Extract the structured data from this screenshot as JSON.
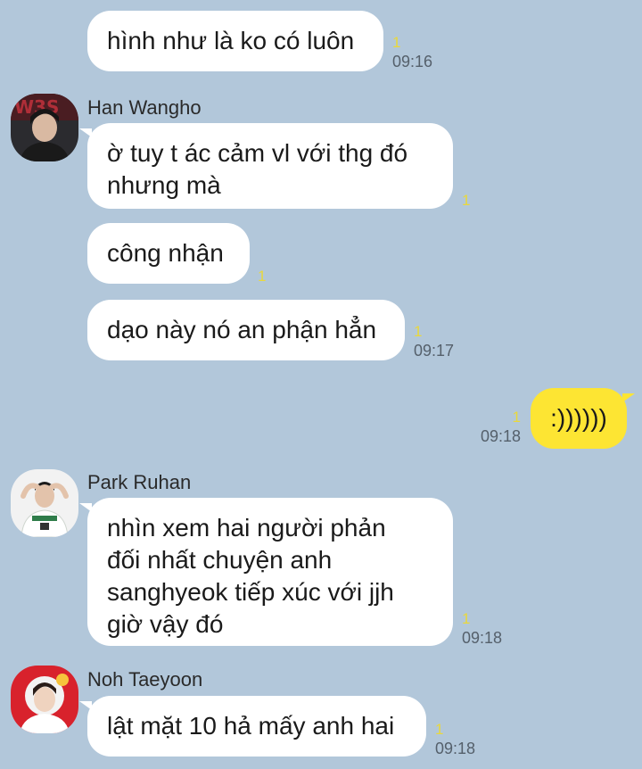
{
  "messages": {
    "m1": {
      "text": "hình như là ko có luôn",
      "unread": "1",
      "time": "09:16"
    },
    "m2": {
      "sender": "Han Wangho",
      "text": "ờ tuy t ác cảm vl với thg đó\nnhưng mà",
      "unread": "1"
    },
    "m3": {
      "text": "công nhận",
      "unread": "1"
    },
    "m4": {
      "text": "dạo này nó an phận hẳn",
      "unread": "1",
      "time": "09:17"
    },
    "m5": {
      "text": ":))))))",
      "unread": "1",
      "time": "09:18"
    },
    "m6": {
      "sender": "Park Ruhan",
      "text": "nhìn xem hai người phản\nđối nhất chuyện anh\nsanghyeok tiếp xúc với jjh\ngiờ vậy đó",
      "unread": "1",
      "time": "09:18"
    },
    "m7": {
      "sender": "Noh Taeyoon",
      "text": "lật mặt 10 hả mấy anh hai",
      "unread": "1",
      "time": "09:18"
    }
  },
  "colors": {
    "background": "#b2c7da",
    "incoming_bubble": "#ffffff",
    "outgoing_bubble": "#fde533",
    "unread_count": "#e9d83c"
  },
  "icons": {
    "avatar_han": "avatar-han-wangho",
    "avatar_park": "avatar-park-ruhan",
    "avatar_noh": "avatar-noh-taeyoon"
  }
}
